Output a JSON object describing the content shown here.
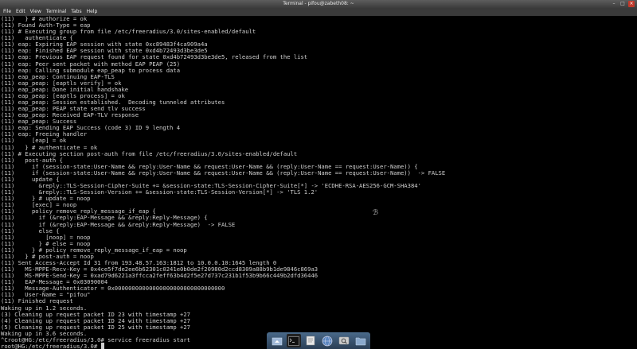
{
  "window": {
    "title": "Terminal - pifou@zabeth08: ~"
  },
  "menu": {
    "items": [
      "File",
      "Edit",
      "View",
      "Terminal",
      "Tabs",
      "Help"
    ]
  },
  "terminal": {
    "lines": [
      "(11)   } # authorize = ok",
      "(11) Found Auth-Type = eap",
      "(11) # Executing group from file /etc/freeradius/3.0/sites-enabled/default",
      "(11)   authenticate {",
      "(11) eap: Expiring EAP session with state 0xc89483f4ca909a4a",
      "(11) eap: Finished EAP session with state 0xd4b72493d3be3de5",
      "(11) eap: Previous EAP request found for state 0xd4b72493d3be3de5, released from the list",
      "(11) eap: Peer sent packet with method EAP PEAP (25)",
      "(11) eap: Calling submodule eap_peap to process data",
      "(11) eap_peap: Continuing EAP-TLS",
      "(11) eap_peap: [eaptls verify] = ok",
      "(11) eap_peap: Done initial handshake",
      "(11) eap_peap: [eaptls process] = ok",
      "(11) eap_peap: Session established.  Decoding tunneled attributes",
      "(11) eap_peap: PEAP state send tlv success",
      "(11) eap_peap: Received EAP-TLV response",
      "(11) eap_peap: Success",
      "(11) eap: Sending EAP Success (code 3) ID 9 length 4",
      "(11) eap: Freeing handler",
      "(11)     [eap] = ok",
      "(11)   } # authenticate = ok",
      "(11) # Executing section post-auth from file /etc/freeradius/3.0/sites-enabled/default",
      "(11)   post-auth {",
      "(11)     if (session-state:User-Name && reply:User-Name && request:User-Name && (reply:User-Name == request:User-Name)) {",
      "(11)     if (session-state:User-Name && reply:User-Name && request:User-Name && (reply:User-Name == request:User-Name))  -> FALSE",
      "(11)     update {",
      "(11)       &reply::TLS-Session-Cipher-Suite += &session-state:TLS-Session-Cipher-Suite[*] -> 'ECDHE-RSA-AES256-GCM-SHA384'",
      "(11)       &reply::TLS-Session-Version += &session-state:TLS-Session-Version[*] -> 'TLS 1.2'",
      "(11)     } # update = noop",
      "(11)     [exec] = noop",
      "(11)     policy remove_reply_message_if_eap {",
      "(11)       if (&reply:EAP-Message && &reply:Reply-Message) {",
      "(11)       if (&reply:EAP-Message && &reply:Reply-Message)  -> FALSE",
      "(11)       else {",
      "(11)         [noop] = noop",
      "(11)       } # else = noop",
      "(11)     } # policy remove_reply_message_if_eap = noop",
      "(11)   } # post-auth = noop",
      "(11) Sent Access-Accept Id 31 from 193.48.57.163:1812 to 10.0.0.10:1645 length 0",
      "(11)   MS-MPPE-Recv-Key = 0x4ce5f7de2ee6b62301c0241e0b0de2f20980d2ccd8309a88b9b1de9846c869a3",
      "(11)   MS-MPPE-Send-Key = 0xad79d6221a3ffcca2feff63b4d2f5e27d737c231b1f53b9b66c449b2dfd36446",
      "(11)   EAP-Message = 0x03090004",
      "(11)   Message-Authenticator = 0x00000000000000000000000000000000",
      "(11)   User-Name = \"pifou\"",
      "(11) Finished request",
      "Waking up in 1.2 seconds.",
      "(3) Cleaning up request packet ID 23 with timestamp +27",
      "(4) Cleaning up request packet ID 24 with timestamp +27",
      "(5) Cleaning up request packet ID 25 with timestamp +27",
      "Waking up in 3.6 seconds.",
      "^Croot@HG:/etc/freeradius/3.0# service freeradius start",
      "root@HG:/etc/freeradius/3.0# "
    ]
  },
  "icons": {
    "minimize": "minimize-icon",
    "maximize": "maximize-icon",
    "close": "close-icon",
    "dock": [
      "home-folder-icon",
      "terminal-icon",
      "files-icon",
      "web-browser-icon",
      "search-icon",
      "folder-icon"
    ]
  },
  "colors": {
    "terminal_bg": "#000000",
    "terminal_fg": "#cfcfcf",
    "close_button": "#c0392b"
  }
}
